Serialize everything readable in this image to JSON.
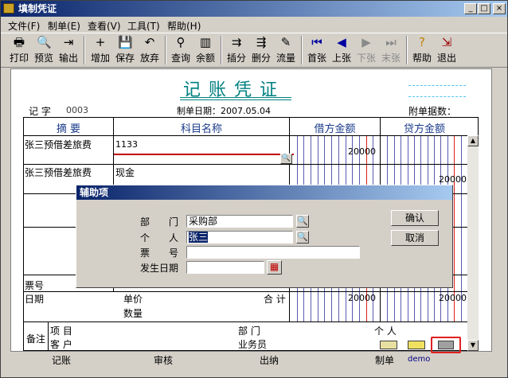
{
  "window": {
    "title": "填制凭证",
    "btn_min": "_",
    "btn_max": "□",
    "btn_close": "×"
  },
  "menu": [
    "文件(F)",
    "制单(E)",
    "查看(V)",
    "工具(T)",
    "帮助(H)"
  ],
  "toolbar": [
    {
      "label": "打印",
      "icon": "printer-icon",
      "glyph": "🖶"
    },
    {
      "label": "预览",
      "icon": "preview-icon",
      "glyph": "🔍"
    },
    {
      "label": "输出",
      "icon": "export-icon",
      "glyph": "⇥"
    },
    {
      "label": "增加",
      "icon": "add-icon",
      "glyph": "+"
    },
    {
      "label": "保存",
      "icon": "save-icon",
      "glyph": "💾"
    },
    {
      "label": "放弃",
      "icon": "undo-icon",
      "glyph": "↶"
    },
    {
      "label": "查询",
      "icon": "binoculars-icon",
      "glyph": "⚲"
    },
    {
      "label": "余额",
      "icon": "balance-chart-icon",
      "glyph": "▥"
    },
    {
      "label": "插分",
      "icon": "insert-row-icon",
      "glyph": "⇉"
    },
    {
      "label": "删分",
      "icon": "delete-row-icon",
      "glyph": "⇶"
    },
    {
      "label": "流量",
      "icon": "cashflow-icon",
      "glyph": "✎"
    },
    {
      "label": "首张",
      "icon": "first-icon",
      "glyph": "⏮"
    },
    {
      "label": "上张",
      "icon": "prev-icon",
      "glyph": "◀"
    },
    {
      "label": "下张",
      "icon": "next-icon",
      "glyph": "▶"
    },
    {
      "label": "末张",
      "icon": "last-icon",
      "glyph": "⏭"
    },
    {
      "label": "帮助",
      "icon": "help-icon",
      "glyph": "?"
    },
    {
      "label": "退出",
      "icon": "exit-icon",
      "glyph": "⇲"
    }
  ],
  "voucher": {
    "title": "记账凭证",
    "type_label": "记 字",
    "number": "0003",
    "date_label": "制单日期：2007.05.04",
    "attach_label": "附单据数：",
    "headers": {
      "summary": "摘 要",
      "account": "科目名称",
      "debit": "借方金额",
      "credit": "贷方金额"
    },
    "rows": [
      {
        "summary": "张三预借差旅费",
        "account": "1133",
        "debit": "20000",
        "credit": ""
      },
      {
        "summary": "张三预借差旅费",
        "account": "现金",
        "debit": "",
        "credit": "20000"
      }
    ],
    "footer": {
      "ticket_no": "票号",
      "date": "日期",
      "unit_price": "单价",
      "quantity": "数量",
      "total_label": "合 计",
      "total_debit": "20000",
      "total_credit": "20000",
      "remark": "备注",
      "project": "项 目",
      "customer": "客 户",
      "department": "部 门",
      "salesperson": "业务员",
      "person": "个 人"
    },
    "signatures": {
      "bookkeeping": "记账",
      "audit": "审核",
      "cashier": "出纳",
      "maker": "制单",
      "maker_name": "demo"
    }
  },
  "dialog": {
    "title": "辅助项",
    "dept_label": "部　　门",
    "dept_value": "采购部",
    "person_label": "个　　人",
    "person_value": "张三",
    "ticket_label": "票　　号",
    "ticket_value": "",
    "date_label": "发生日期",
    "date_value": "",
    "ok": "确认",
    "cancel": "取消"
  }
}
